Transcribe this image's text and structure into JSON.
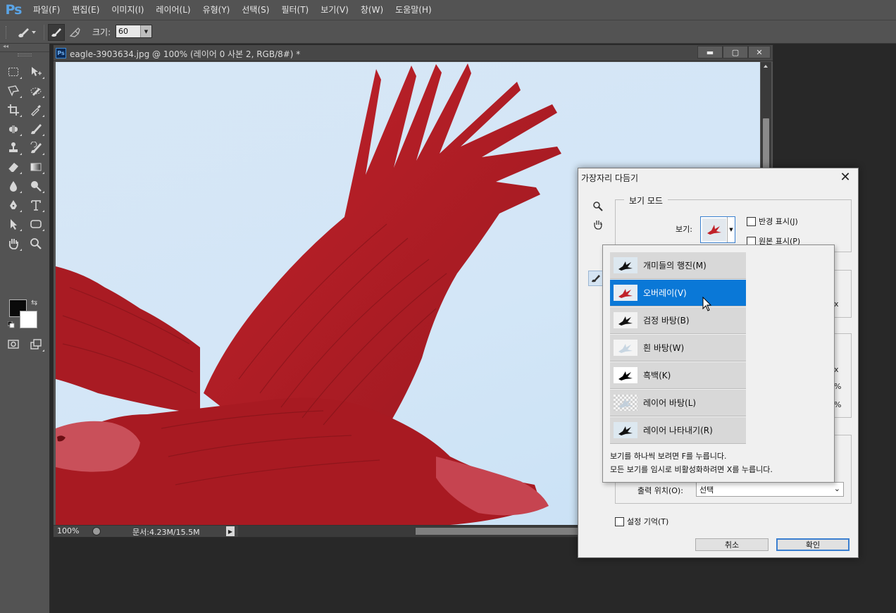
{
  "app": {
    "logo": "Ps",
    "menu": [
      "파일(F)",
      "편집(E)",
      "이미지(I)",
      "레이어(L)",
      "유형(Y)",
      "선택(S)",
      "필터(T)",
      "보기(V)",
      "창(W)",
      "도움말(H)"
    ]
  },
  "options_bar": {
    "size_label": "크기:",
    "size_value": "60"
  },
  "document": {
    "title": "eagle-3903634.jpg @ 100% (레이어 0 사본 2, RGB/8#) *",
    "zoom": "100%",
    "doc_size": "문서:4.23M/15.5M"
  },
  "dialog": {
    "title": "가장자리 다듬기",
    "view_mode_group": "보기 모드",
    "view_label": "보기:",
    "show_radius": "반경 표시(J)",
    "show_original": "원본 표시(P)",
    "output_label": "출력 위치(O):",
    "output_value": "선택",
    "remember": "설정 기억(T)",
    "cancel": "취소",
    "ok": "확인"
  },
  "view_dropdown": {
    "items": [
      {
        "label": "개미들의 행진(M)",
        "thumb": "black-eagle",
        "selected": false
      },
      {
        "label": "오버레이(V)",
        "thumb": "red-eagle",
        "selected": true
      },
      {
        "label": "검정 바탕(B)",
        "thumb": "black-eagle",
        "selected": false
      },
      {
        "label": "흰 바탕(W)",
        "thumb": "white-eagle",
        "selected": false
      },
      {
        "label": "흑백(K)",
        "thumb": "black-eagle",
        "selected": false
      },
      {
        "label": "레이어 바탕(L)",
        "thumb": "checker-eagle",
        "selected": false
      },
      {
        "label": "레이어 나타내기(R)",
        "thumb": "black-eagle",
        "selected": false
      }
    ],
    "hint_1": "보기를 하나씩 보려면 F를 누릅니다.",
    "hint_2": "모든 보기를 임시로 비활성화하려면 X를 누릅니다."
  },
  "colors": {
    "overlay_red": "#b01a22",
    "selection_blue": "#0a78d7",
    "sky": "#d3e6f7"
  }
}
